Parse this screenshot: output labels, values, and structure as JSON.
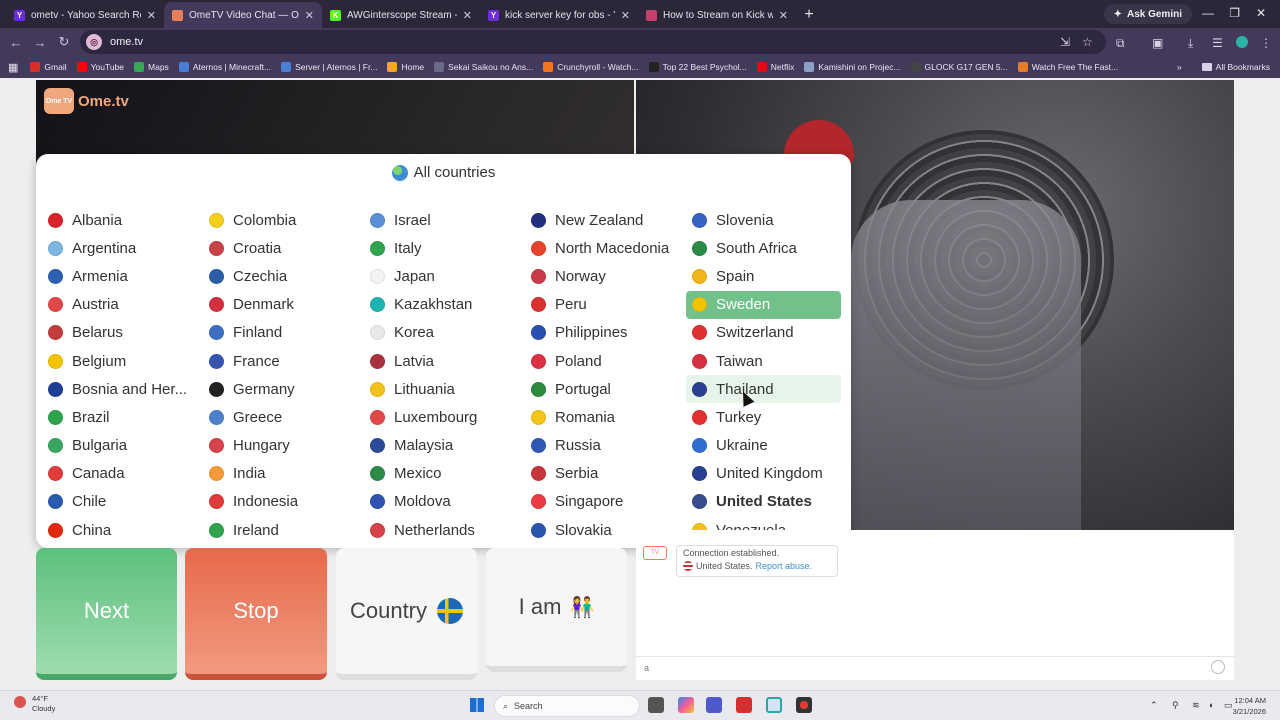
{
  "browser": {
    "tabs": [
      {
        "title": "ometv - Yahoo Search Results",
        "fav_color": "#6e2bd9",
        "fav_text": "Y",
        "active": false
      },
      {
        "title": "OmeTV Video Chat — Ome",
        "fav_color": "#e97e5b",
        "fav_text": "",
        "active": true
      },
      {
        "title": "AWGinterscope Stream - Watch",
        "fav_color": "#53fc18",
        "fav_text": "K",
        "active": false
      },
      {
        "title": "kick server key for obs - Yahoo",
        "fav_color": "#6e2bd9",
        "fav_text": "Y",
        "active": false
      },
      {
        "title": "How to Stream on Kick with OB",
        "fav_color": "#c43f6b",
        "fav_text": "",
        "active": false
      }
    ],
    "new_tab": "+",
    "ask_gemini": "Ask Gemini",
    "url": "ome.tv",
    "bookmarks": [
      {
        "label": "Gmail",
        "color": "#d93025"
      },
      {
        "label": "YouTube",
        "color": "#ff0000"
      },
      {
        "label": "Maps",
        "color": "#34a853"
      },
      {
        "label": "Aternos | Minecraft...",
        "color": "#4a7fd6"
      },
      {
        "label": "Server | Aternos | Fr...",
        "color": "#4a7fd6"
      },
      {
        "label": "Home",
        "color": "#f5a623"
      },
      {
        "label": "Sekai Saikou no Ans...",
        "color": "#6a6a8a"
      },
      {
        "label": "Crunchyroll - Watch...",
        "color": "#f47521"
      },
      {
        "label": "Top 22 Best Psychol...",
        "color": "#222222"
      },
      {
        "label": "Netflix",
        "color": "#e50914"
      },
      {
        "label": "Kamishini on Projec...",
        "color": "#8aa0c8"
      },
      {
        "label": "GLOCK G17 GEN 5...",
        "color": "#444444"
      },
      {
        "label": "Watch Free The Fast...",
        "color": "#e87a2c"
      }
    ],
    "all_bookmarks": "All Bookmarks"
  },
  "site": {
    "logo_text": "Ome.tv",
    "logo_badge": "Ome TV"
  },
  "country_popup": {
    "header": "All countries",
    "columns": [
      [
        {
          "name": "Albania",
          "flag": "#d8232a"
        },
        {
          "name": "Argentina",
          "flag": "#7fb5e3"
        },
        {
          "name": "Armenia",
          "flag": "#2f5fb3"
        },
        {
          "name": "Austria",
          "flag": "#e04848"
        },
        {
          "name": "Belarus",
          "flag": "#c43c3c"
        },
        {
          "name": "Belgium",
          "flag": "#f3c300"
        },
        {
          "name": "Bosnia and Her...",
          "flag": "#1e3f96"
        },
        {
          "name": "Brazil",
          "flag": "#2fa34a"
        },
        {
          "name": "Bulgaria",
          "flag": "#3aa55e"
        },
        {
          "name": "Canada",
          "flag": "#e23b3b"
        },
        {
          "name": "Chile",
          "flag": "#2b5bb0"
        },
        {
          "name": "China",
          "flag": "#de2910"
        }
      ],
      [
        {
          "name": "Colombia",
          "flag": "#f6cf1c"
        },
        {
          "name": "Croatia",
          "flag": "#c9424a"
        },
        {
          "name": "Czechia",
          "flag": "#2a5ea8"
        },
        {
          "name": "Denmark",
          "flag": "#d43040"
        },
        {
          "name": "Finland",
          "flag": "#3c6fc2"
        },
        {
          "name": "France",
          "flag": "#3755b0"
        },
        {
          "name": "Germany",
          "flag": "#222222"
        },
        {
          "name": "Greece",
          "flag": "#4d80cc"
        },
        {
          "name": "Hungary",
          "flag": "#d7434a"
        },
        {
          "name": "India",
          "flag": "#f59a36"
        },
        {
          "name": "Indonesia",
          "flag": "#e03a3a"
        },
        {
          "name": "Ireland",
          "flag": "#2ea44f"
        }
      ],
      [
        {
          "name": "Israel",
          "flag": "#5b8fd6"
        },
        {
          "name": "Italy",
          "flag": "#2ea44f"
        },
        {
          "name": "Japan",
          "flag": "#f3f3f3"
        },
        {
          "name": "Kazakhstan",
          "flag": "#1eb4b4"
        },
        {
          "name": "Korea",
          "flag": "#e9e9e9"
        },
        {
          "name": "Latvia",
          "flag": "#a8323d"
        },
        {
          "name": "Lithuania",
          "flag": "#f2c21a"
        },
        {
          "name": "Luxembourg",
          "flag": "#e04848"
        },
        {
          "name": "Malaysia",
          "flag": "#2b4a99"
        },
        {
          "name": "Mexico",
          "flag": "#2b8a48"
        },
        {
          "name": "Moldova",
          "flag": "#2d54b0"
        },
        {
          "name": "Netherlands",
          "flag": "#d6424a"
        }
      ],
      [
        {
          "name": "New Zealand",
          "flag": "#23307e"
        },
        {
          "name": "North Macedonia",
          "flag": "#e5432c"
        },
        {
          "name": "Norway",
          "flag": "#c83a46"
        },
        {
          "name": "Peru",
          "flag": "#d93030"
        },
        {
          "name": "Philippines",
          "flag": "#2950b0"
        },
        {
          "name": "Poland",
          "flag": "#dc2f43"
        },
        {
          "name": "Portugal",
          "flag": "#2d8a3c"
        },
        {
          "name": "Romania",
          "flag": "#f3c519"
        },
        {
          "name": "Russia",
          "flag": "#2f57b5"
        },
        {
          "name": "Serbia",
          "flag": "#c6363c"
        },
        {
          "name": "Singapore",
          "flag": "#ec3b43"
        },
        {
          "name": "Slovakia",
          "flag": "#2a55ad"
        }
      ],
      [
        {
          "name": "Slovenia",
          "flag": "#3763c2"
        },
        {
          "name": "South Africa",
          "flag": "#2b8a48"
        },
        {
          "name": "Spain",
          "flag": "#f2b51a"
        },
        {
          "name": "Sweden",
          "flag": "#f2c400",
          "selected": true
        },
        {
          "name": "Switzerland",
          "flag": "#e03030"
        },
        {
          "name": "Taiwan",
          "flag": "#d63040"
        },
        {
          "name": "Thailand",
          "flag": "#2a3f91",
          "hover": true
        },
        {
          "name": "Turkey",
          "flag": "#e23030"
        },
        {
          "name": "Ukraine",
          "flag": "#2f6fd1"
        },
        {
          "name": "United Kingdom",
          "flag": "#2a3f91"
        },
        {
          "name": "United States",
          "flag": "#3a4b8e",
          "bold": true
        },
        {
          "name": "Venezuela",
          "flag": "#f2c21a"
        }
      ]
    ]
  },
  "controls": {
    "next": "Next",
    "stop": "Stop",
    "country": "Country",
    "iam": "I am",
    "iam_icon": "👫"
  },
  "chat": {
    "status": "Connection established.",
    "country": "United States.",
    "report": "Report abuse.",
    "input_value": "a",
    "tv_badge": "TV"
  },
  "taskbar": {
    "temp": "44°F",
    "weather": "Cloudy",
    "search": "Search",
    "time": "12:04 AM",
    "date": "3/21/2026"
  }
}
